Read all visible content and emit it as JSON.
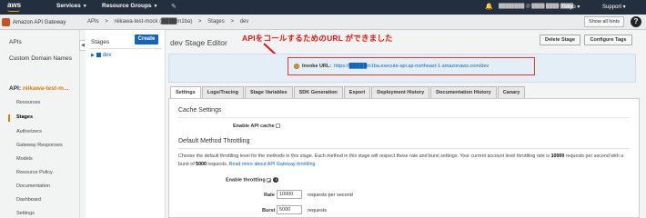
{
  "topbar": {
    "logo": "aws",
    "services": "Services",
    "resource_groups": "Resource Groups",
    "account": "████████ @ ████-████-████",
    "region": "Tokyo",
    "support": "Support"
  },
  "subbar": {
    "service_name": "Amazon API Gateway",
    "breadcrumbs": [
      "APIs",
      ">",
      "niikawa-test-mock (████m1ba)",
      ">",
      "Stages",
      ">",
      "dev"
    ],
    "show_hints": "Show all hints",
    "help": "?"
  },
  "leftnav": {
    "apis": "APIs",
    "custom_domains": "Custom Domain Names",
    "api_prefix": "API:",
    "api_name": "niikawa-test-m...",
    "items": [
      "Resources",
      "Stages",
      "Authorizers",
      "Gateway Responses",
      "Models",
      "Resource Policy",
      "Documentation",
      "Dashboard",
      "Settings"
    ],
    "active": "Stages"
  },
  "stages_panel": {
    "title": "Stages",
    "create": "Create",
    "stage": "dev"
  },
  "main": {
    "title": "dev Stage Editor",
    "delete_stage": "Delete Stage",
    "configure_tags": "Configure Tags",
    "annotation": "APIをコールするためのURL ができました",
    "invoke_label": "Invoke URL:",
    "invoke_url": "https://█████m1ba.execute-api.ap-northeast-1.amazonaws.com/dev",
    "tabs": [
      "Settings",
      "Logs/Tracing",
      "Stage Variables",
      "SDK Generation",
      "Export",
      "Deployment History",
      "Documentation History",
      "Canary"
    ],
    "active_tab": "Settings"
  },
  "settings": {
    "cache_heading": "Cache Settings",
    "enable_cache_label": "Enable API cache",
    "throttling_heading": "Default Method Throttling",
    "desc_part1": "Choose the default throttling level for the methods in this stage. Each method in this stage will respect these rate and burst settings. Your current account level throttling rate is ",
    "account_rate": "10000",
    "desc_part2": " requests per second with a burst of ",
    "account_burst": "5000",
    "desc_part3": " requests.",
    "desc_link": "Read more about API Gateway throttling",
    "enable_throttling_label": "Enable throttling",
    "rate_label": "Rate",
    "rate_value": "10000",
    "rate_unit": "requests per second",
    "burst_label": "Burst",
    "burst_value": "5000",
    "burst_unit": "requests"
  },
  "colors": {
    "topbar": "#232f3e",
    "accent_orange": "#ff9900",
    "link_blue": "#1166bb",
    "annotation_red": "#ee1111"
  }
}
